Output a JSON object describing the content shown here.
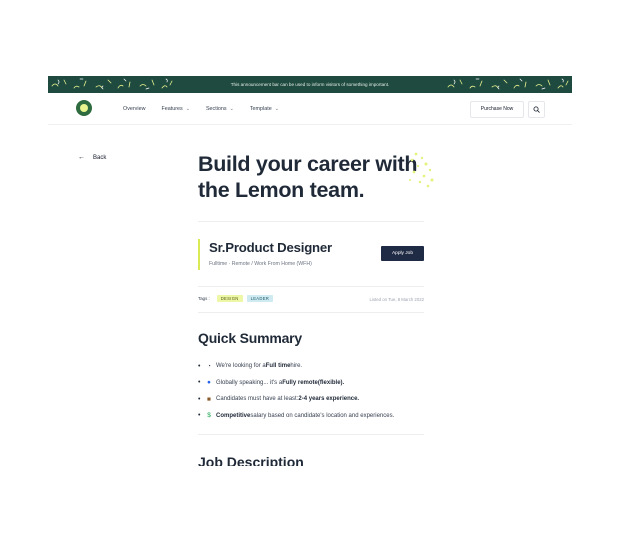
{
  "announcement": {
    "text": "This announcement bar can be used to inform visitors of something important."
  },
  "nav": {
    "items": [
      {
        "label": "Overview",
        "has_dropdown": false
      },
      {
        "label": "Features",
        "has_dropdown": true
      },
      {
        "label": "Sections",
        "has_dropdown": true
      },
      {
        "label": "Template",
        "has_dropdown": true
      }
    ],
    "purchase_label": "Purchase Now",
    "search_icon": "search-icon"
  },
  "back_label": "Back",
  "hero": {
    "line1": "Build your career with",
    "line2": "the Lemon team."
  },
  "job": {
    "title": "Sr.Product Designer",
    "meta": "Fulltime · Remote / Work From Home (WFH)",
    "apply_label": "Apply Job"
  },
  "tags": {
    "label": "Tags :",
    "items": [
      "DESIGN",
      "LEADER"
    ],
    "listed": "Listed on Tue, 8 March 2022"
  },
  "summary": {
    "title": "Quick Summary",
    "items": [
      {
        "icon": "clock-icon",
        "pre": "We're looking for a ",
        "bold": "Full time",
        "post": " hire."
      },
      {
        "icon": "globe-icon",
        "pre": "Globally speaking... it's a ",
        "bold": "Fully remote(flexible).",
        "post": ""
      },
      {
        "icon": "briefcase-icon",
        "pre": "Candidates must have at least: ",
        "bold": "2-4 years experience.",
        "post": ""
      },
      {
        "icon": "money-icon",
        "pre": "",
        "bold": "Competitive",
        "post": " salary based on candidate's location and experiences."
      }
    ]
  },
  "next_section_title": "Job Description",
  "colors": {
    "announcement_bg": "#1f4a3f",
    "accent": "#d9ea55",
    "apply_bg": "#1f2a44"
  }
}
